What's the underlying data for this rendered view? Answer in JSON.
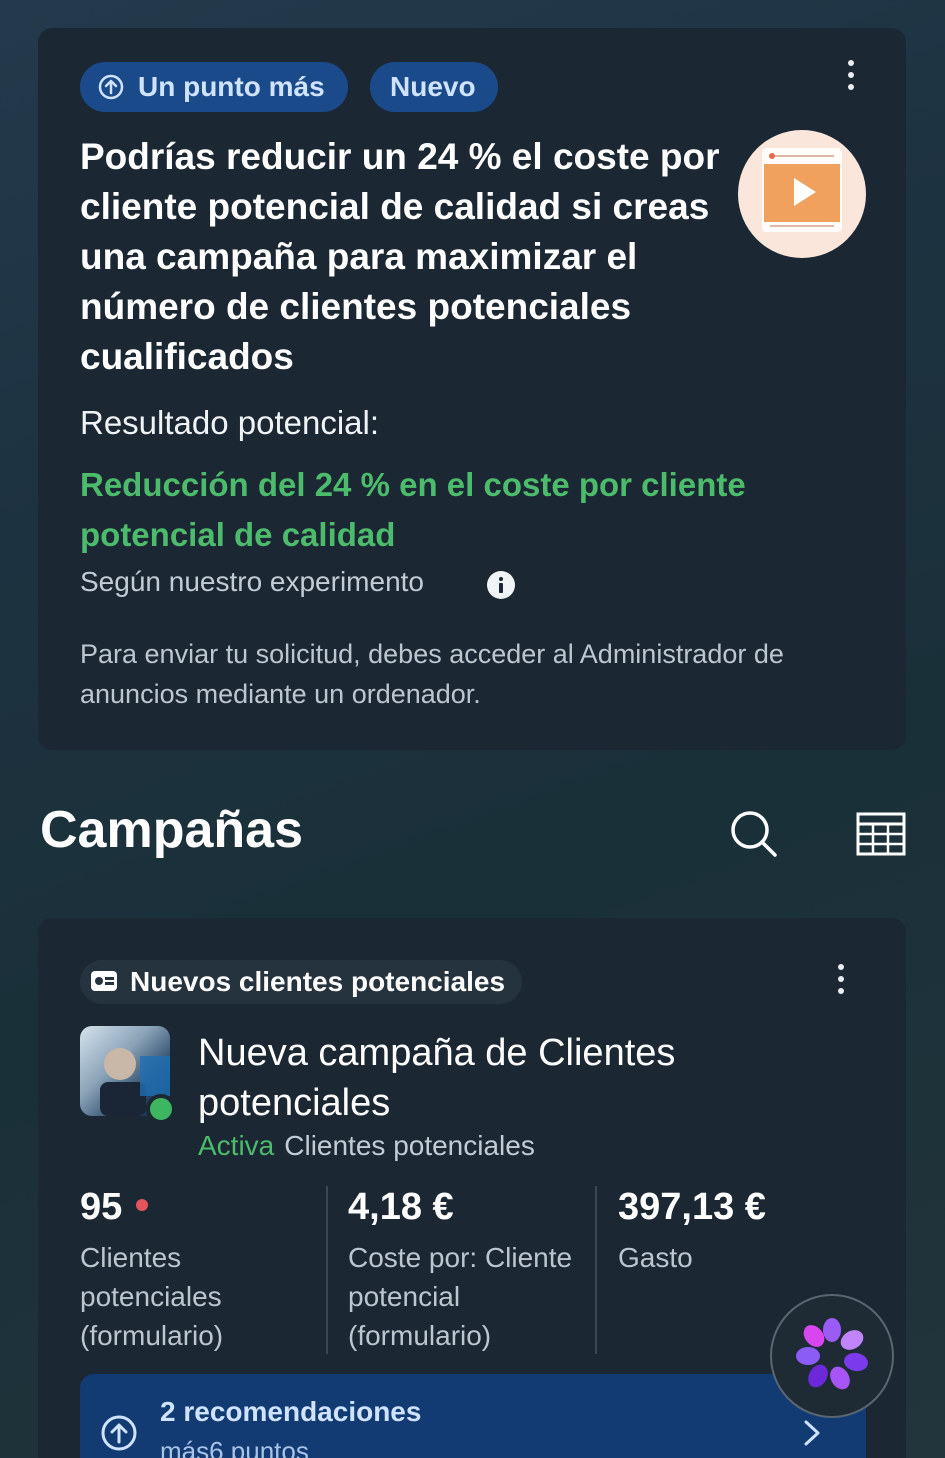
{
  "tip_card": {
    "badge_primary": "Un punto más",
    "badge_secondary": "Nuevo",
    "headline": "Podrías reducir un 24 % el coste por cliente potencial de calidad si creas una campaña para maximizar el número de clientes potenciales cualificados",
    "result_label": "Resultado potencial:",
    "result_value": "Reducción del 24 % en el coste por cliente potencial de calidad",
    "source": "Según nuestro experimento",
    "note": "Para enviar tu solicitud, debes acceder al Administrador de anuncios mediante un ordenador."
  },
  "campaigns": {
    "title": "Campañas"
  },
  "campaign_card": {
    "tag": "Nuevos clientes potenciales",
    "name": "Nueva campaña de Clientes potenciales",
    "status": "Activa",
    "objective": "Clientes potenciales",
    "metrics": [
      {
        "value": "95",
        "label": "Clientes potenciales (formulario)"
      },
      {
        "value": "4,18 €",
        "label": "Coste por: Cliente potencial (formulario)"
      },
      {
        "value": "397,13 €",
        "label": "Gasto"
      }
    ],
    "recommendations": {
      "title": "2 recomendaciones",
      "subtitle": "más6 puntos"
    }
  },
  "colors": {
    "accent_green": "#4cbb6c",
    "badge_blue": "#1a4a8a",
    "card_bg": "#1b2833",
    "alert_red": "#e5545c"
  },
  "icons": [
    "arrow-up-circle-icon",
    "kebab-menu-icon",
    "video-play-icon",
    "info-icon",
    "search-icon",
    "table-icon",
    "lead-form-icon",
    "chevron-right-icon",
    "meta-ai-icon"
  ]
}
